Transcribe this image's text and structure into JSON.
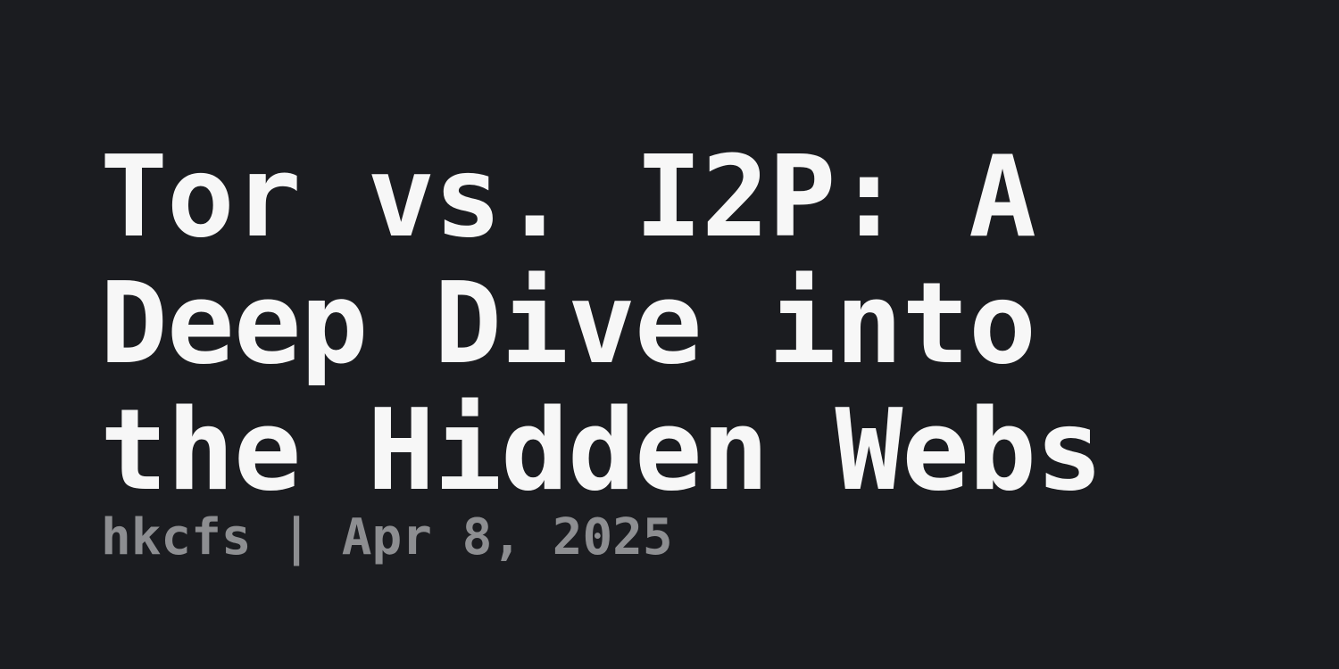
{
  "post": {
    "title_lines": [
      "Tor vs. I2P: A",
      "Deep Dive into",
      "the Hidden Webs"
    ],
    "author": "hkcfs",
    "separator": " | ",
    "date": "Apr 8, 2025"
  },
  "colors": {
    "background": "#1b1c20",
    "title": "#f7f7f7",
    "meta": "#8d8e91"
  }
}
